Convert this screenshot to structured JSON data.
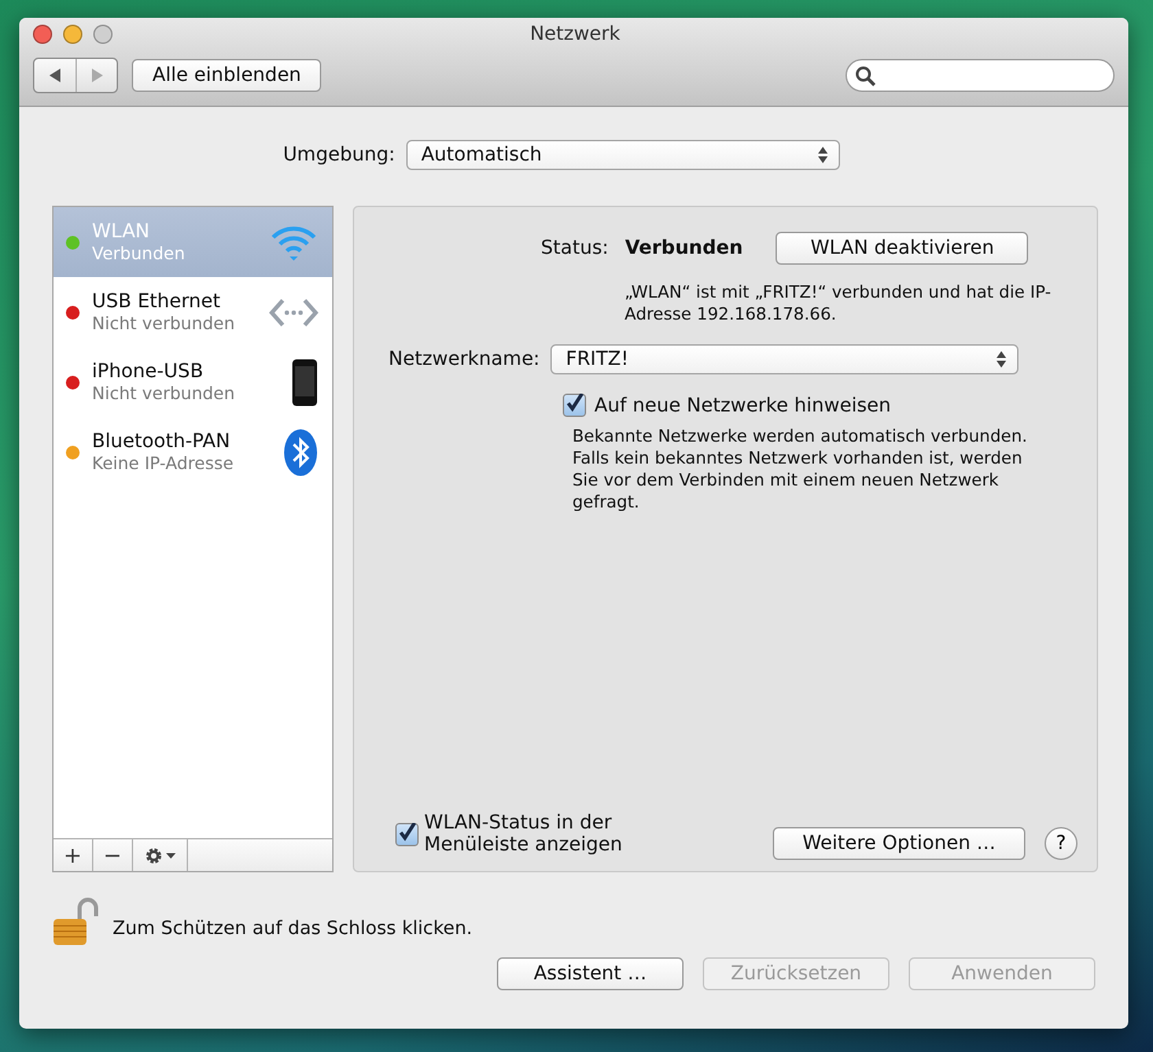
{
  "window": {
    "title": "Netzwerk"
  },
  "toolbar": {
    "show_all_button": "Alle einblenden"
  },
  "location": {
    "label": "Umgebung:",
    "value": "Automatisch"
  },
  "services": [
    {
      "name": "WLAN",
      "status": "Verbunden",
      "color": "#5ec224",
      "selected": true,
      "kind": "wifi"
    },
    {
      "name": "USB Ethernet",
      "status": "Nicht verbunden",
      "color": "#d81e1e",
      "selected": false,
      "kind": "ethernet"
    },
    {
      "name": "iPhone-USB",
      "status": "Nicht verbunden",
      "color": "#d81e1e",
      "selected": false,
      "kind": "phone"
    },
    {
      "name": "Bluetooth-PAN",
      "status": "Keine IP-Adresse",
      "color": "#f0a020",
      "selected": false,
      "kind": "bluetooth"
    }
  ],
  "list_buttons": [
    "+",
    "−"
  ],
  "status": {
    "label": "Status:",
    "value": "Verbunden",
    "button": "WLAN deaktivieren",
    "description": "„WLAN“ ist mit „FRITZ!“ verbunden und hat die IP-Adresse 192.168.178.66."
  },
  "network_name": {
    "label": "Netzwerkname:",
    "value": "FRITZ!"
  },
  "ask_new": {
    "label": "Auf neue Netzwerke hinweisen",
    "checked": true,
    "description": "Bekannte Netzwerke werden automatisch verbunden. Falls kein bekanntes Netzwerk vorhanden ist, werden Sie vor dem Verbinden mit einem neuen Netzwerk gefragt."
  },
  "show_status": {
    "label": "WLAN-Status in der Menüleiste anzeigen",
    "checked": true
  },
  "advanced_button": "Weitere Optionen …",
  "help_button": "?",
  "lock": {
    "text": "Zum Schützen auf das Schloss klicken.",
    "locked": false
  },
  "buttons": [
    {
      "label": "Assistent …",
      "disabled": false
    },
    {
      "label": "Zurücksetzen",
      "disabled": true
    },
    {
      "label": "Anwenden",
      "disabled": true
    }
  ]
}
